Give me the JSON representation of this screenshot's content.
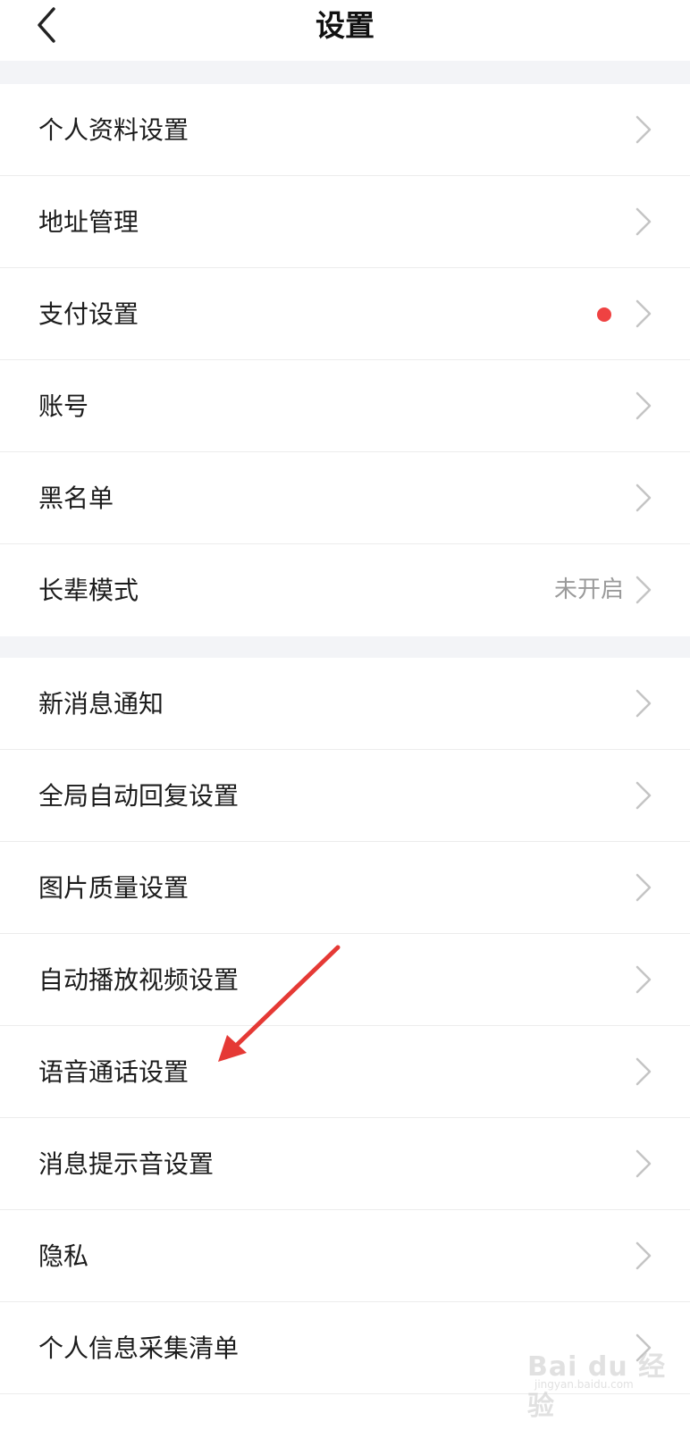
{
  "header": {
    "title": "设置",
    "back_icon": "chevron-left-icon"
  },
  "group1": {
    "items": [
      {
        "label": "个人资料设置"
      },
      {
        "label": "地址管理"
      },
      {
        "label": "支付设置",
        "badge": "red-dot"
      },
      {
        "label": "账号"
      },
      {
        "label": "黑名单"
      },
      {
        "label": "长辈模式",
        "value": "未开启"
      }
    ]
  },
  "group2": {
    "items": [
      {
        "label": "新消息通知"
      },
      {
        "label": "全局自动回复设置"
      },
      {
        "label": "图片质量设置"
      },
      {
        "label": "自动播放视频设置"
      },
      {
        "label": "语音通话设置"
      },
      {
        "label": "消息提示音设置"
      },
      {
        "label": "隐私"
      },
      {
        "label": "个人信息采集清单"
      }
    ]
  },
  "colors": {
    "background_gap": "#f3f4f7",
    "red_dot": "#ef4242",
    "annotation_arrow": "#e53935"
  },
  "watermark": {
    "text": "Bai du 经验",
    "sub": "jingyan.baidu.com"
  }
}
